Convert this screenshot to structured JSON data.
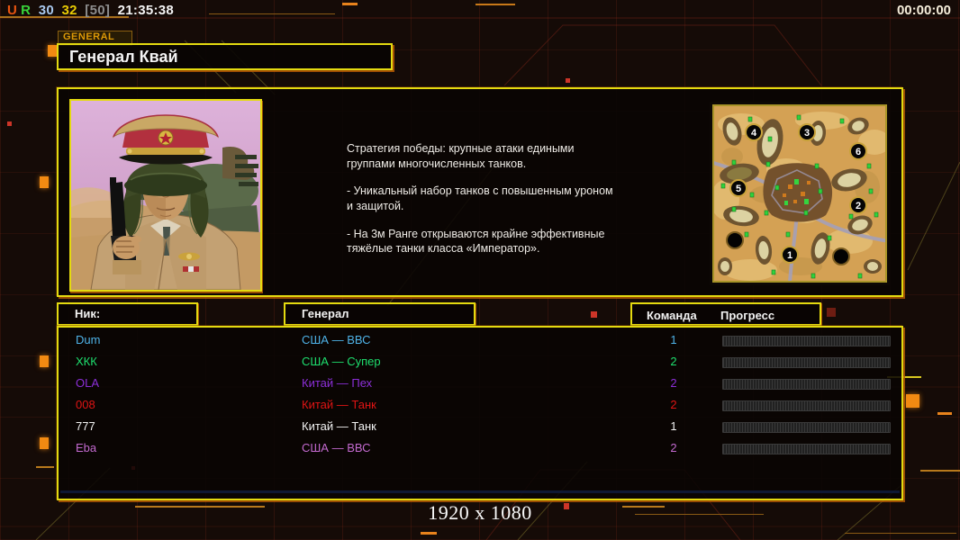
{
  "status_bar": {
    "ur_u": "U",
    "ur_r": "R",
    "value_1": "30",
    "value_2": "32",
    "value_3": "[50]",
    "clock": "21:35:38",
    "match_timer": "00:00:00"
  },
  "header": {
    "tab_label": "GENERAL",
    "title": "Генерал Квай"
  },
  "briefing": {
    "paragraphs": [
      "Стратегия победы: крупные атаки едиными\n группами многочисленных танков.",
      "- Уникальный набор танков с повышенным уроном\n и защитой.",
      "- На 3м Ранге открываются крайне эффективные\n тяжёлые танки класса «Император»."
    ]
  },
  "map_preview": {
    "spawn_labels": [
      "1",
      "2",
      "3",
      "4",
      "5",
      "6"
    ]
  },
  "players_table": {
    "headers": {
      "nick": "Ник:",
      "general": "Генерал",
      "team": "Команда",
      "progress": "Прогресс"
    },
    "rows": [
      {
        "nick": "Dum",
        "general": "США — ВВС",
        "team": "1",
        "color": "#4fb3e8",
        "progress_percent": 0
      },
      {
        "nick": "ХКК",
        "general": "США — Супер",
        "team": "2",
        "color": "#1ede6e",
        "progress_percent": 0
      },
      {
        "nick": "OLA",
        "general": "Китай — Пех",
        "team": "2",
        "color": "#8c2fd8",
        "progress_percent": 0
      },
      {
        "nick": "008",
        "general": "Китай — Танк",
        "team": "2",
        "color": "#e01414",
        "progress_percent": 0
      },
      {
        "nick": "777",
        "general": "Китай — Танк",
        "team": "1",
        "color": "#f2f2f2",
        "progress_percent": 0
      },
      {
        "nick": "Eba",
        "general": "США — ВВС",
        "team": "2",
        "color": "#c46ad0",
        "progress_percent": 0
      }
    ]
  },
  "footer": {
    "resolution": "1920 x 1080"
  },
  "colors": {
    "accent_yellow": "#e4da10",
    "accent_orange": "#e8831c"
  }
}
